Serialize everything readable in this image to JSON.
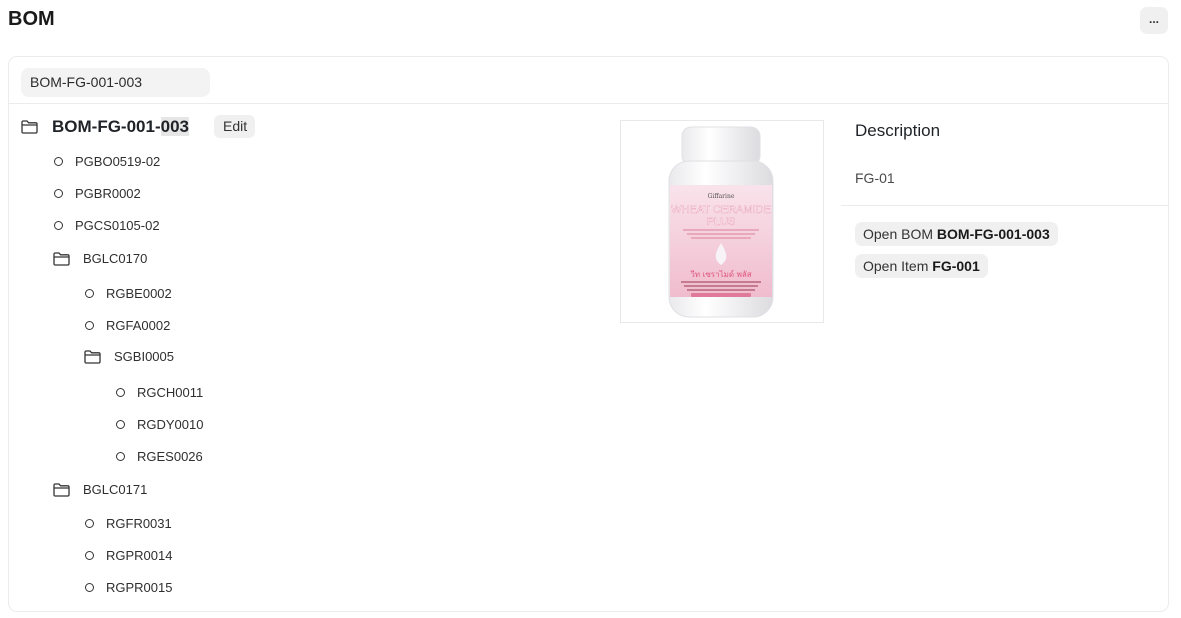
{
  "page": {
    "title": "BOM"
  },
  "header": {
    "more_label": "..."
  },
  "selector": {
    "value": "BOM-FG-001-003"
  },
  "tree": {
    "root": {
      "label_prefix": "BOM-FG-001-",
      "label_highlight": "003",
      "edit_label": "Edit"
    },
    "items": {
      "n1": "PGBO0519-02",
      "n2": "PGBR0002",
      "n3": "PGCS0105-02",
      "g1": "BGLC0170",
      "n4": "RGBE0002",
      "n5": "RGFA0002",
      "g2": "SGBI0005",
      "n6": "RGCH0011",
      "n7": "RGDY0010",
      "n8": "RGES0026",
      "g3": "BGLC0171",
      "n9": "RGFR0031",
      "n10": "RGPR0014",
      "n11": "RGPR0015"
    }
  },
  "product": {
    "brand": "Giffarine",
    "name_line1": "WHEAT CERAMIDE",
    "name_line2": "PLUS",
    "thai_name": "วีท เซราไมด์ พลัส",
    "cap_color": "#f4f4f4",
    "label_color": "#f3c6d4",
    "accent_color": "#e07a9a"
  },
  "details": {
    "description_title": "Description",
    "description_value": "FG-01",
    "open_bom_prefix": "Open BOM",
    "open_bom_value": "BOM-FG-001-003",
    "open_item_prefix": "Open Item",
    "open_item_value": "FG-001"
  }
}
